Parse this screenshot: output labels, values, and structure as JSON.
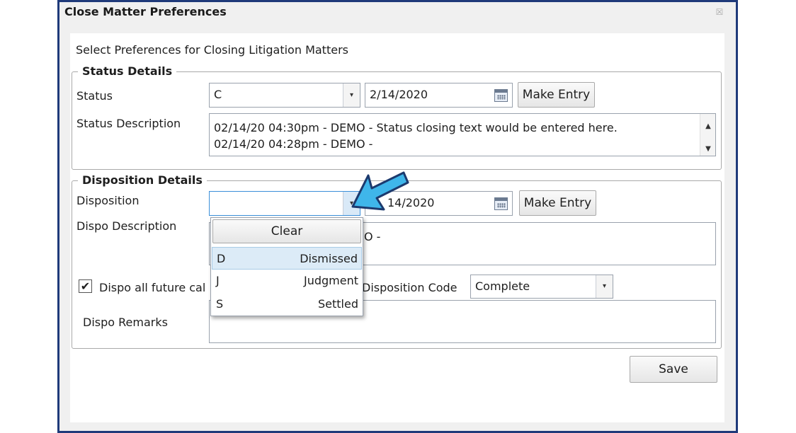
{
  "window": {
    "title": "Close Matter Preferences",
    "close_glyph": "☒"
  },
  "intro": "Select Preferences for Closing Litigation Matters",
  "status_group": {
    "legend": "Status Details",
    "status_label": "Status",
    "status_value": "C",
    "status_date": "2/14/2020",
    "make_entry": "Make Entry",
    "description_label": "Status Description",
    "description_lines": [
      "02/14/20 04:30pm - DEMO - Status closing text would be entered here.",
      "02/14/20 04:28pm - DEMO -"
    ]
  },
  "disposition_group": {
    "legend": "Disposition Details",
    "disposition_label": "Disposition",
    "disposition_value": "",
    "disposition_date": "2/14/2020",
    "disposition_date_visible": "14/2020",
    "make_entry": "Make Entry",
    "description_label": "Dispo Description",
    "description_visible": "O -",
    "checkbox_label": "Dispo all future cal",
    "checkbox_checked": true,
    "disposition_code_label": "Disposition Code",
    "disposition_code_value": "Complete",
    "remarks_label": "Dispo Remarks",
    "remarks_value": ""
  },
  "dropdown": {
    "clear_label": "Clear",
    "options": [
      {
        "code": "D",
        "name": "Dismissed",
        "selected": true
      },
      {
        "code": "J",
        "name": "Judgment",
        "selected": false
      },
      {
        "code": "S",
        "name": "Settled",
        "selected": false
      }
    ]
  },
  "save_label": "Save",
  "icons": {
    "dropdown_arrow": "▾",
    "scroll_up": "▲",
    "scroll_down": "▼",
    "checkmark": "✔"
  },
  "colors": {
    "window_border": "#1f3a7a",
    "annotation_arrow": "#3fb6ea",
    "selected_item": "#dcebf7"
  }
}
